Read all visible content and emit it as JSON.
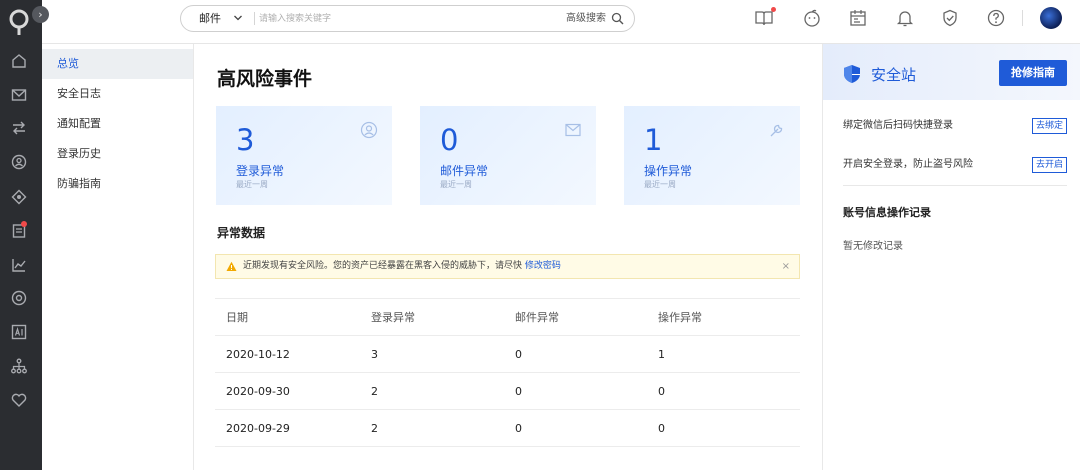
{
  "search": {
    "scope": "邮件",
    "placeholder": "请输入搜索关键字",
    "advanced_label": "高级搜索"
  },
  "sidebar": {
    "items": [
      {
        "label": "总览",
        "active": true
      },
      {
        "label": "安全日志",
        "active": false
      },
      {
        "label": "通知配置",
        "active": false
      },
      {
        "label": "登录历史",
        "active": false
      },
      {
        "label": "防骗指南",
        "active": false
      }
    ]
  },
  "main": {
    "title": "高风险事件",
    "cards": [
      {
        "value": "3",
        "label": "登录异常",
        "sub": "最近一周",
        "icon": "user-circle-icon"
      },
      {
        "value": "0",
        "label": "邮件异常",
        "sub": "最近一周",
        "icon": "envelope-icon"
      },
      {
        "value": "1",
        "label": "操作异常",
        "sub": "最近一周",
        "icon": "wrench-icon"
      }
    ],
    "section_title": "异常数据",
    "alert": {
      "text": "近期发现有安全风险。您的资产已经暴露在黑客入侵的威胁下，请尽快",
      "link": "修改密码",
      "close": "×"
    },
    "table": {
      "headers": [
        "日期",
        "登录异常",
        "邮件异常",
        "操作异常"
      ],
      "rows": [
        [
          "2020-10-12",
          "3",
          "0",
          "1"
        ],
        [
          "2020-09-30",
          "2",
          "0",
          "0"
        ],
        [
          "2020-09-29",
          "2",
          "0",
          "0"
        ]
      ]
    }
  },
  "right": {
    "title": "安全站",
    "guide_button": "抢修指南",
    "items": [
      {
        "text": "绑定微信后扫码快捷登录",
        "action": "去绑定"
      },
      {
        "text": "开启安全登录，防止盗号风险",
        "action": "去开启"
      }
    ],
    "log_title": "账号信息操作记录",
    "log_empty": "暂无修改记录"
  },
  "colors": {
    "accent": "#1f5bd8",
    "rail": "#2b2d31",
    "alert_bg": "#fffbe6",
    "notify_dot": "#f04a4a"
  },
  "icons": {
    "rail": [
      "logo-icon",
      "home-icon",
      "mail-icon",
      "transfer-icon",
      "contact-icon",
      "compass-icon",
      "document-icon",
      "chart-icon",
      "settings-icon",
      "ai-icon",
      "org-icon",
      "heart-icon"
    ],
    "topbar": [
      "book-icon",
      "face-icon",
      "calendar-icon",
      "bell-icon",
      "shield-check-icon",
      "help-icon"
    ]
  }
}
